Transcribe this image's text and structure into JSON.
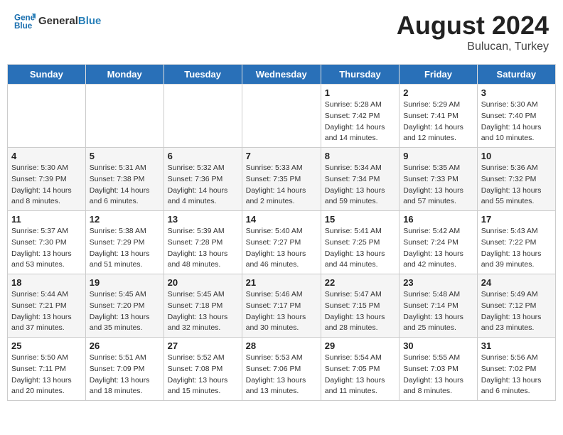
{
  "header": {
    "logo_line1": "General",
    "logo_line2": "Blue",
    "month_year": "August 2024",
    "location": "Bulucan, Turkey"
  },
  "days_of_week": [
    "Sunday",
    "Monday",
    "Tuesday",
    "Wednesday",
    "Thursday",
    "Friday",
    "Saturday"
  ],
  "weeks": [
    [
      {
        "day": "",
        "info": ""
      },
      {
        "day": "",
        "info": ""
      },
      {
        "day": "",
        "info": ""
      },
      {
        "day": "",
        "info": ""
      },
      {
        "day": "1",
        "info": "Sunrise: 5:28 AM\nSunset: 7:42 PM\nDaylight: 14 hours\nand 14 minutes."
      },
      {
        "day": "2",
        "info": "Sunrise: 5:29 AM\nSunset: 7:41 PM\nDaylight: 14 hours\nand 12 minutes."
      },
      {
        "day": "3",
        "info": "Sunrise: 5:30 AM\nSunset: 7:40 PM\nDaylight: 14 hours\nand 10 minutes."
      }
    ],
    [
      {
        "day": "4",
        "info": "Sunrise: 5:30 AM\nSunset: 7:39 PM\nDaylight: 14 hours\nand 8 minutes."
      },
      {
        "day": "5",
        "info": "Sunrise: 5:31 AM\nSunset: 7:38 PM\nDaylight: 14 hours\nand 6 minutes."
      },
      {
        "day": "6",
        "info": "Sunrise: 5:32 AM\nSunset: 7:36 PM\nDaylight: 14 hours\nand 4 minutes."
      },
      {
        "day": "7",
        "info": "Sunrise: 5:33 AM\nSunset: 7:35 PM\nDaylight: 14 hours\nand 2 minutes."
      },
      {
        "day": "8",
        "info": "Sunrise: 5:34 AM\nSunset: 7:34 PM\nDaylight: 13 hours\nand 59 minutes."
      },
      {
        "day": "9",
        "info": "Sunrise: 5:35 AM\nSunset: 7:33 PM\nDaylight: 13 hours\nand 57 minutes."
      },
      {
        "day": "10",
        "info": "Sunrise: 5:36 AM\nSunset: 7:32 PM\nDaylight: 13 hours\nand 55 minutes."
      }
    ],
    [
      {
        "day": "11",
        "info": "Sunrise: 5:37 AM\nSunset: 7:30 PM\nDaylight: 13 hours\nand 53 minutes."
      },
      {
        "day": "12",
        "info": "Sunrise: 5:38 AM\nSunset: 7:29 PM\nDaylight: 13 hours\nand 51 minutes."
      },
      {
        "day": "13",
        "info": "Sunrise: 5:39 AM\nSunset: 7:28 PM\nDaylight: 13 hours\nand 48 minutes."
      },
      {
        "day": "14",
        "info": "Sunrise: 5:40 AM\nSunset: 7:27 PM\nDaylight: 13 hours\nand 46 minutes."
      },
      {
        "day": "15",
        "info": "Sunrise: 5:41 AM\nSunset: 7:25 PM\nDaylight: 13 hours\nand 44 minutes."
      },
      {
        "day": "16",
        "info": "Sunrise: 5:42 AM\nSunset: 7:24 PM\nDaylight: 13 hours\nand 42 minutes."
      },
      {
        "day": "17",
        "info": "Sunrise: 5:43 AM\nSunset: 7:22 PM\nDaylight: 13 hours\nand 39 minutes."
      }
    ],
    [
      {
        "day": "18",
        "info": "Sunrise: 5:44 AM\nSunset: 7:21 PM\nDaylight: 13 hours\nand 37 minutes."
      },
      {
        "day": "19",
        "info": "Sunrise: 5:45 AM\nSunset: 7:20 PM\nDaylight: 13 hours\nand 35 minutes."
      },
      {
        "day": "20",
        "info": "Sunrise: 5:45 AM\nSunset: 7:18 PM\nDaylight: 13 hours\nand 32 minutes."
      },
      {
        "day": "21",
        "info": "Sunrise: 5:46 AM\nSunset: 7:17 PM\nDaylight: 13 hours\nand 30 minutes."
      },
      {
        "day": "22",
        "info": "Sunrise: 5:47 AM\nSunset: 7:15 PM\nDaylight: 13 hours\nand 28 minutes."
      },
      {
        "day": "23",
        "info": "Sunrise: 5:48 AM\nSunset: 7:14 PM\nDaylight: 13 hours\nand 25 minutes."
      },
      {
        "day": "24",
        "info": "Sunrise: 5:49 AM\nSunset: 7:12 PM\nDaylight: 13 hours\nand 23 minutes."
      }
    ],
    [
      {
        "day": "25",
        "info": "Sunrise: 5:50 AM\nSunset: 7:11 PM\nDaylight: 13 hours\nand 20 minutes."
      },
      {
        "day": "26",
        "info": "Sunrise: 5:51 AM\nSunset: 7:09 PM\nDaylight: 13 hours\nand 18 minutes."
      },
      {
        "day": "27",
        "info": "Sunrise: 5:52 AM\nSunset: 7:08 PM\nDaylight: 13 hours\nand 15 minutes."
      },
      {
        "day": "28",
        "info": "Sunrise: 5:53 AM\nSunset: 7:06 PM\nDaylight: 13 hours\nand 13 minutes."
      },
      {
        "day": "29",
        "info": "Sunrise: 5:54 AM\nSunset: 7:05 PM\nDaylight: 13 hours\nand 11 minutes."
      },
      {
        "day": "30",
        "info": "Sunrise: 5:55 AM\nSunset: 7:03 PM\nDaylight: 13 hours\nand 8 minutes."
      },
      {
        "day": "31",
        "info": "Sunrise: 5:56 AM\nSunset: 7:02 PM\nDaylight: 13 hours\nand 6 minutes."
      }
    ]
  ]
}
